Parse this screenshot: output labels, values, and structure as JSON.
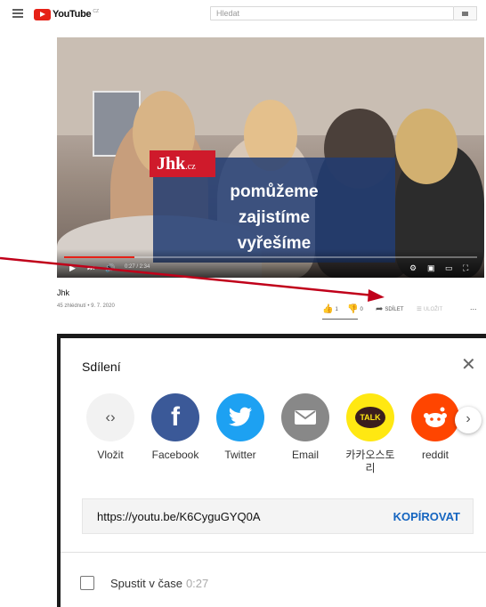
{
  "header": {
    "logo_text": "YouTube",
    "logo_suffix": "CZ",
    "search_placeholder": "Hledat"
  },
  "video": {
    "overlay_brand": "Jhk",
    "overlay_brand_suffix": ".cz",
    "overlay_lines": [
      "pomůžeme",
      "zajistíme",
      "vyřešíme"
    ],
    "time_text": "0:27 / 2:34",
    "progress_fraction": 0.17
  },
  "info": {
    "title": "Jhk",
    "meta": "45 zhlédnutí • 9. 7. 2020",
    "likes": "1",
    "dislikes": "0",
    "share_label": "SDÍLET",
    "save_label": "ULOŽIT",
    "more_label": "..."
  },
  "dialog": {
    "title": "Sdílení",
    "close_icon": "close-icon",
    "targets": [
      {
        "label": "Vložit",
        "icon": "embed-icon",
        "color": "#f2f2f2"
      },
      {
        "label": "Facebook",
        "icon": "facebook-icon",
        "color": "#3b5998"
      },
      {
        "label": "Twitter",
        "icon": "twitter-icon",
        "color": "#1da1f2"
      },
      {
        "label": "Email",
        "icon": "email-icon",
        "color": "#888888"
      },
      {
        "label": "카카오스토리",
        "icon": "kakao-icon",
        "color": "#ffe812",
        "badge": "TALK"
      },
      {
        "label": "reddit",
        "icon": "reddit-icon",
        "color": "#ff4500"
      }
    ],
    "url": "https://youtu.be/K6CyguGYQ0A",
    "copy_label": "KOPÍROVAT",
    "start_label": "Spustit v čase",
    "start_time": "0:27"
  },
  "colors": {
    "youtube_red": "#e62117",
    "link_blue": "#1565c0",
    "arrow_red": "#c0001a"
  }
}
